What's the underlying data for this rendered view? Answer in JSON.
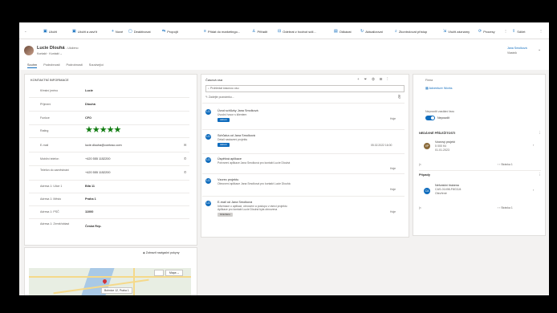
{
  "toolbar": {
    "back": "←",
    "items": [
      "Uložit",
      "Uložit a zavřít",
      "Nové",
      "Deaktivovat",
      "Propojit",
      "Přidat do marketingo...",
      "Přiřadit",
      "Odebrat z hodnot sdíl...",
      "Odkázat",
      "Aktualizovat",
      "Zkontrolovat přístup",
      "Vložit záznamy",
      "Procesy",
      "Sdílet"
    ]
  },
  "header": {
    "name": "Lucie Dlouhá",
    "saved": "- Uloženo",
    "entity": "Kontakt",
    "form": "Kontakt",
    "owner_name": "Jana Smolková",
    "owner_label": "Vlastník"
  },
  "tabs": [
    "Souhrn",
    "Podrobnosti",
    "Podrobnosti",
    "Související"
  ],
  "contact": {
    "section_title": "KONTAKTNÍ INFORMACE",
    "fields": [
      {
        "label": "Křestní jméno",
        "value": "Lucie"
      },
      {
        "label": "Příjmení",
        "value": "Dlouhá"
      },
      {
        "label": "Funkce",
        "value": "CFO"
      },
      {
        "label": "Rating",
        "value": "★★★★★"
      },
      {
        "label": "E-mail",
        "value": "lucie.dlouha@contoso.com"
      },
      {
        "label": "Mobilní telefon",
        "value": "+420 555 1152200"
      },
      {
        "label": "Telefon do zaměstnání",
        "value": "+420 555 1152200"
      },
      {
        "label": "Adresa 1: Ulice 1",
        "value": "Bílá 11"
      },
      {
        "label": "Adresa 1: Město",
        "value": "Praha 1"
      },
      {
        "label": "Adresa 1: PSČ",
        "value": "11000"
      },
      {
        "label": "Adresa 1: Země/oblast",
        "value": "Česká Rep."
      }
    ],
    "map_button": "Zobrazit navigační pokyny",
    "map_type": "Mapa",
    "map_place": "Bohnice 12, Praha 1"
  },
  "timeline": {
    "title": "Časová osa",
    "search_placeholder": "Prohledat časovou osu",
    "note_placeholder": "Zadejte poznámku...",
    "items": [
      {
        "initials": "LD",
        "title": "Úvod schůzky Jana Smolková",
        "sub": "Úvodní hovor s klientem",
        "badge": "Aktivní",
        "date": "Hoje"
      },
      {
        "initials": "LD",
        "title": "Schůzka od Jana Smolková",
        "sub": "Detail nastavení projektu",
        "badge": "Aktivní",
        "date": "05.02.2022 16:00"
      },
      {
        "initials": "LD",
        "title": "Úspěšná aplikace",
        "sub": "Potvrzení aplikace Jana Smolková pro kontakt Lucie Dlouhá",
        "badge": "",
        "date": "Hoje"
      },
      {
        "initials": "LD",
        "title": "Vzorec projektu",
        "sub": "Obnovení aplikace Jana Smolková pro kontakt Lucie Dlouhá",
        "badge": "",
        "date": "Hoje"
      },
      {
        "initials": "LD",
        "title": "E-mail od Jana Smolková",
        "sub": "Informace o aplikaci, obnovení a postupu v rámci projektu",
        "sub2": "Aplikace pro kontakt Lucie Dlouhá byla obnovena",
        "badge": "Uzavřeno",
        "date": "Hoje"
      }
    ]
  },
  "right": {
    "account_label": "Firma",
    "account_value": "Adventure Works",
    "toggle_label": "Nepovolit zasílání faxu",
    "toggle_value": "Nepovolit",
    "opportunities_title": "NEDÁVNÉ PŘÍLEŽITOSTI",
    "opp": {
      "initials": "VP",
      "name": "Vzorový projekt",
      "amount": "5 000 Kč",
      "date": "01.01.2023"
    },
    "pager1": "Stránka 1",
    "cases_title": "Případy",
    "case": {
      "initials": "CA",
      "name": "Nefunkční tiskárna",
      "number": "CAS-01498-F8G3J4",
      "status": "Otevřené"
    },
    "pager2": "Stránka 1"
  }
}
